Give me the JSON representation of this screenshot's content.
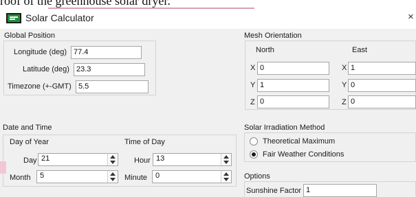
{
  "document_fragment": "roof of the greenhouse solar dryer.",
  "window": {
    "title": "Solar Calculator",
    "close_glyph": "×"
  },
  "global_position": {
    "title": "Global Position",
    "longitude": {
      "label": "Longitude (deg)",
      "value": "77.4"
    },
    "latitude": {
      "label": "Latitude (deg)",
      "value": "23.3"
    },
    "timezone": {
      "label": "Timezone (+-GMT)",
      "value": "5.5"
    }
  },
  "mesh_orientation": {
    "title": "Mesh Orientation",
    "north": {
      "header": "North",
      "x_label": "X",
      "x": "0",
      "y_label": "Y",
      "y": "1",
      "z_label": "Z",
      "z": "0"
    },
    "east": {
      "header": "East",
      "x_label": "X",
      "x": "1",
      "y_label": "Y",
      "y": "0",
      "z_label": "Z",
      "z": "0"
    }
  },
  "date_time": {
    "title": "Date and Time",
    "day_of_year": {
      "title": "Day of Year",
      "day": {
        "label": "Day",
        "value": "21"
      },
      "month": {
        "label": "Month",
        "value": "5"
      }
    },
    "time_of_day": {
      "title": "Time of Day",
      "hour": {
        "label": "Hour",
        "value": "13"
      },
      "minute": {
        "label": "Minute",
        "value": "0"
      }
    }
  },
  "solar_irradiation": {
    "title": "Solar Irradiation Method",
    "options": [
      {
        "label": "Theoretical Maximum",
        "selected": false
      },
      {
        "label": "Fair Weather Conditions",
        "selected": true
      }
    ]
  },
  "options": {
    "title": "Options",
    "sunshine_factor": {
      "label": "Sunshine Factor",
      "value": "1"
    }
  },
  "colors": {
    "app_icon_green": "#1f8f3a",
    "field_border": "#a5a5a5",
    "dialog_bg": "#f0f0f0"
  }
}
